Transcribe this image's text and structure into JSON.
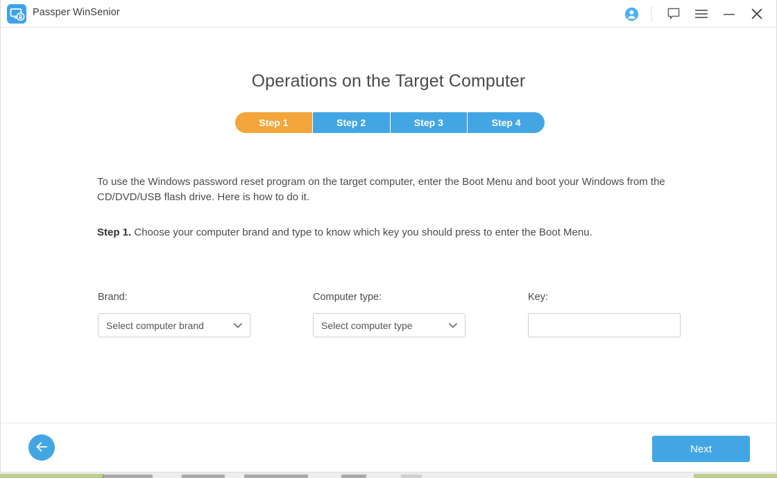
{
  "window": {
    "app_title": "Passper WinSenior",
    "logo_icon": "monitor-lock-icon",
    "titlebar": {
      "account_icon": "account-circle-icon",
      "feedback_icon": "speech-bubble-icon",
      "menu_icon": "hamburger-menu-icon",
      "minimize_icon": "minimize-icon",
      "close_icon": "close-icon"
    },
    "accent_color": "#43a6e4",
    "active_step_color": "#f2a63b"
  },
  "content": {
    "page_title": "Operations on the Target Computer",
    "stepper": {
      "active_index": 0,
      "steps": [
        {
          "label": "Step 1"
        },
        {
          "label": "Step 2"
        },
        {
          "label": "Step 3"
        },
        {
          "label": "Step 4"
        }
      ]
    },
    "intro_paragraph": "To use the Windows password reset program on the target computer, enter the Boot Menu and boot your Windows from the CD/DVD/USB flash drive. Here is how to do it.",
    "step_instruction": {
      "lead": "Step 1.",
      "text": " Choose your computer brand and type to know which key you should press to enter the Boot Menu."
    },
    "form": {
      "brand": {
        "label": "Brand:",
        "value": "Select computer brand",
        "chevron_icon": "chevron-down-icon"
      },
      "computer_type": {
        "label": "Computer type:",
        "value": "Select computer type",
        "chevron_icon": "chevron-down-icon"
      },
      "key": {
        "label": "Key:",
        "value": "",
        "placeholder": ""
      }
    }
  },
  "footer": {
    "back_icon": "arrow-left-icon",
    "next_label": "Next"
  }
}
